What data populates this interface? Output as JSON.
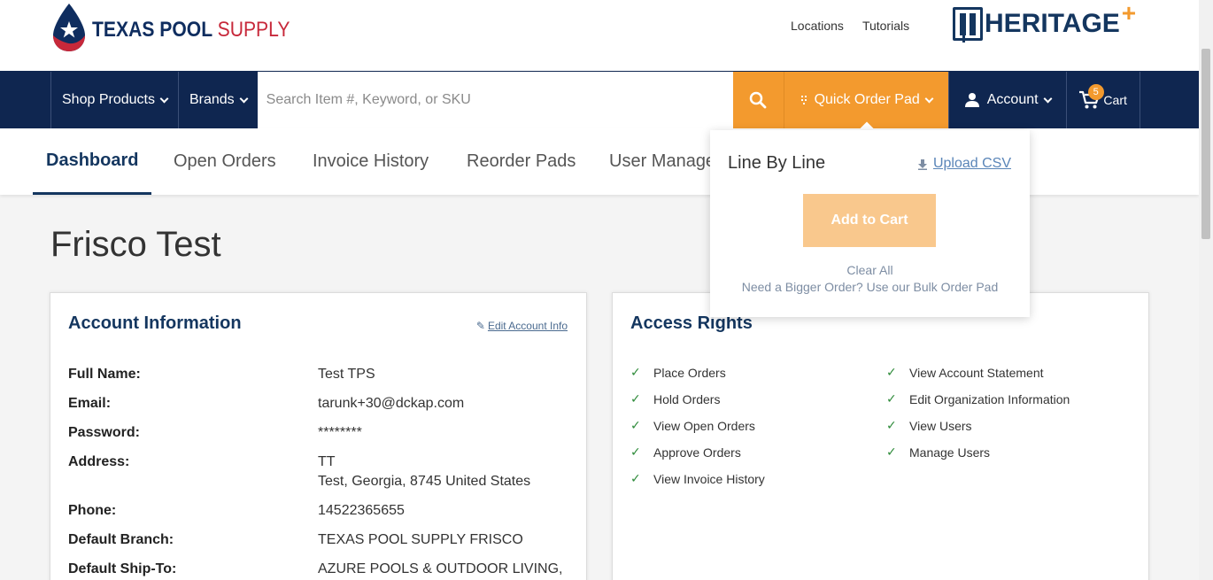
{
  "header": {
    "logo_text_bold": "TEXAS POOL",
    "logo_text_light": "SUPPLY",
    "links": [
      "Locations",
      "Tutorials"
    ],
    "partner_logo": "HERITAGE",
    "partner_plus": "+"
  },
  "nav": {
    "shop_products": "Shop Products",
    "brands": "Brands",
    "search_placeholder": "Search Item #, Keyword, or SKU",
    "quick_order_pad": "Quick Order Pad",
    "account": "Account",
    "cart": "Cart",
    "cart_count": "5"
  },
  "tabs": [
    "Dashboard",
    "Open Orders",
    "Invoice History",
    "Reorder Pads",
    "User Manage"
  ],
  "page_title": "Frisco Test",
  "account_info": {
    "heading": "Account Information",
    "edit_link": "Edit Account Info",
    "rows": [
      {
        "label": "Full Name:",
        "value": "Test TPS"
      },
      {
        "label": "Email:",
        "value": "tarunk+30@dckap.com"
      },
      {
        "label": "Password:",
        "value": "********"
      },
      {
        "label": "Address:",
        "value": "TT",
        "value2": "Test, Georgia, 8745 United States"
      },
      {
        "label": "Phone:",
        "value": "14522365655"
      },
      {
        "label": "Default Branch:",
        "value": "TEXAS POOL SUPPLY FRISCO"
      },
      {
        "label": "Default Ship-To:",
        "value": "AZURE POOLS & OUTDOOR LIVING,"
      }
    ]
  },
  "access_rights": {
    "heading": "Access Rights",
    "left": [
      "Place Orders",
      "Hold Orders",
      "View Open Orders",
      "Approve Orders",
      "View Invoice History"
    ],
    "right": [
      "View Account Statement",
      "Edit Organization Information",
      "View Users",
      "Manage Users"
    ]
  },
  "quick_order_dropdown": {
    "title": "Line By Line",
    "upload": "Upload CSV",
    "add_to_cart": "Add to Cart",
    "clear_all": "Clear All",
    "bulk_text": "Need a Bigger Order? Use our Bulk Order Pad"
  },
  "colors": {
    "navy": "#0f2650",
    "orange": "#f39a2e",
    "check_green": "#2e8b3a",
    "brand_red": "#c7283a"
  }
}
